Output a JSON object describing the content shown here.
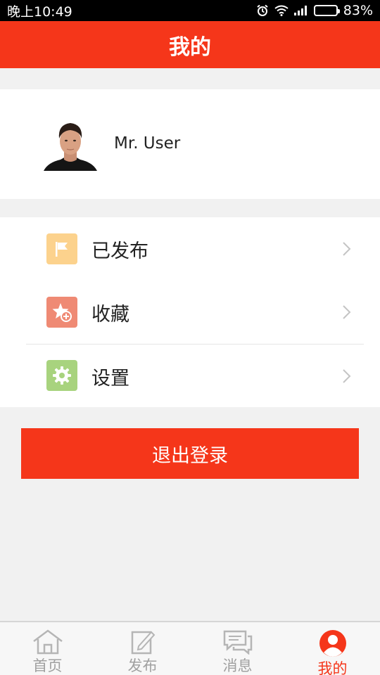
{
  "status_bar": {
    "time": "晚上10:49",
    "battery_percent": "83%",
    "battery_level": 0.83,
    "icons": [
      "alarm-icon",
      "wifi-icon",
      "signal-icon",
      "battery-icon"
    ]
  },
  "header": {
    "title": "我的"
  },
  "profile": {
    "user_name": "Mr. User"
  },
  "menu": {
    "items": [
      {
        "label": "已发布",
        "icon": "flag-icon",
        "color": "#fcd28d"
      },
      {
        "label": "收藏",
        "icon": "star-add-icon",
        "color": "#ef8a74"
      },
      {
        "label": "设置",
        "icon": "gear-icon",
        "color": "#a8d37e"
      }
    ]
  },
  "logout": {
    "label": "退出登录"
  },
  "tabs": [
    {
      "label": "首页",
      "icon": "home-icon",
      "active": false
    },
    {
      "label": "发布",
      "icon": "edit-icon",
      "active": false
    },
    {
      "label": "消息",
      "icon": "chat-icon",
      "active": false
    },
    {
      "label": "我的",
      "icon": "user-icon",
      "active": true
    }
  ],
  "colors": {
    "accent": "#f5361a",
    "inactive_tab": "#a0a0a0",
    "background": "#f1f1f1"
  }
}
